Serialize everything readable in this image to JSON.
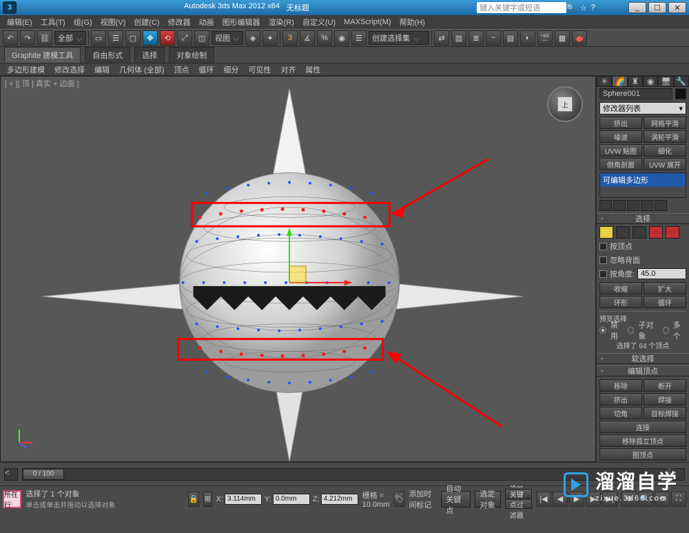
{
  "title": {
    "app": "Autodesk 3ds Max 2012 x64",
    "doc": "无标题",
    "search_placeholder": "键入关键字或短语"
  },
  "winbtns": {
    "min": "_",
    "max": "☐",
    "close": "✕"
  },
  "menu": [
    "编辑(E)",
    "工具(T)",
    "组(G)",
    "视图(V)",
    "创建(C)",
    "修改器",
    "动画",
    "图形编辑器",
    "渲染(R)",
    "自定义(U)",
    "MAXScript(M)",
    "帮助(H)"
  ],
  "toolbar": {
    "layer_combo": "全部",
    "view_combo": "视图",
    "selset_combo": "创建选择集"
  },
  "ribbon": {
    "tabs": [
      "Graphite 建模工具",
      "自由形式",
      "选择",
      "对象绘制"
    ],
    "sub": [
      "多边形建模",
      "修改选择",
      "编辑",
      "几何体 (全部)",
      "顶点",
      "循环",
      "细分",
      "可见性",
      "对齐",
      "属性"
    ]
  },
  "viewport": {
    "label": "[ + ][ 顶 ] 真实 + 边面 ]",
    "cube": "上"
  },
  "cmd": {
    "object_name": "Sphere001",
    "modlist": "修改器列表",
    "mod_buttons": [
      [
        "挤出",
        "网格平滑"
      ],
      [
        "噪波",
        "涡轮平滑"
      ],
      [
        "UVW 贴图",
        "细化"
      ],
      [
        "倒角剖面",
        "UVW 展开"
      ]
    ],
    "stack_item": "可编辑多边形",
    "roll_select": "选择",
    "by_vertex": "按顶点",
    "ignore_backface": "忽略背面",
    "by_angle": "按角度:",
    "angle_val": "45.0",
    "shrink": "收缩",
    "grow": "扩大",
    "ring": "环形",
    "loop": "循环",
    "preview_hdr": "预览选择",
    "preview_opts": [
      "禁用",
      "子对象",
      "多个"
    ],
    "sel_count": "选择了 64 个顶点",
    "roll_softsel": "软选择",
    "roll_editvert": "编辑顶点",
    "edit_rows": [
      [
        "移除",
        "断开"
      ],
      [
        "挤出",
        "焊接"
      ],
      [
        "切角",
        "目标焊接"
      ]
    ],
    "connect": "连接",
    "remove_iso": "移除孤立顶点",
    "remove_unused": "图顶点"
  },
  "timeline": {
    "frame": "0 / 100",
    "add_tag": "添加时间标记"
  },
  "status": {
    "nowhere": "所在行:",
    "sel": "选择了 1 个对象",
    "hint": "单击或单击并拖动以选择对象",
    "x": "3.114mm",
    "y": "0.0mm",
    "z": "4.212mm",
    "grid": "栅格 = 10.0mm",
    "autokey": "自动关键点",
    "selset": "选定对象",
    "setkey": "设置关键点",
    "keyfilter": "关键点过滤器"
  },
  "watermark": {
    "title": "溜溜自学",
    "sub": "zixue.3d66.com"
  }
}
